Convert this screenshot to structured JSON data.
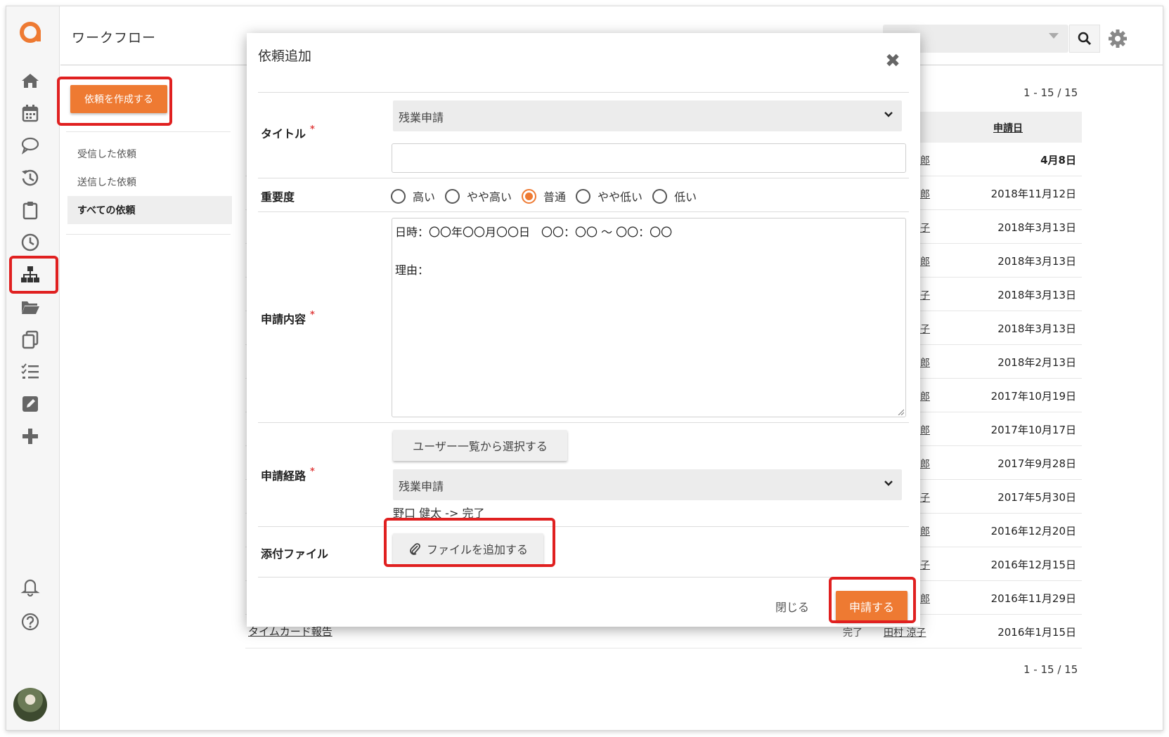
{
  "header": {
    "app_title": "ワークフロー",
    "search_icon": "search-icon",
    "settings_icon": "gear-icon"
  },
  "rail": {
    "items": [
      "logo-icon",
      "home-icon",
      "calendar-icon",
      "chat-icon",
      "history-icon",
      "clipboard-icon",
      "clock-icon",
      "workflow-icon",
      "folder-icon",
      "copy-icon",
      "checklist-icon",
      "edit-icon",
      "plus-icon",
      "bell-icon",
      "help-icon",
      "avatar"
    ]
  },
  "subnav": {
    "create_button": "依頼を作成する",
    "items": [
      {
        "label": "受信した依頼"
      },
      {
        "label": "送信した依頼"
      },
      {
        "label": "すべての依頼"
      }
    ]
  },
  "table": {
    "count_top": "1 - 15 / 15",
    "count_bottom": "1 - 15 / 15",
    "date_header": "申請日",
    "rows": [
      {
        "user": "郎",
        "date": "4月8日"
      },
      {
        "user": "郎",
        "date": "2018年11月12日"
      },
      {
        "user": "子",
        "date": "2018年3月13日"
      },
      {
        "user": "郎",
        "date": "2018年3月13日"
      },
      {
        "user": "子",
        "date": "2018年3月13日"
      },
      {
        "user": "子",
        "date": "2018年3月13日"
      },
      {
        "user": "郎",
        "date": "2018年2月13日"
      },
      {
        "user": "郎",
        "date": "2017年10月19日"
      },
      {
        "user": "郎",
        "date": "2017年10月17日"
      },
      {
        "user": "郎",
        "date": "2017年9月28日"
      },
      {
        "user": "子",
        "date": "2017年5月30日"
      },
      {
        "user": "郎",
        "date": "2016年12月20日"
      },
      {
        "user": "子",
        "date": "2016年12月15日"
      },
      {
        "user": "郎",
        "date": "2016年11月29日"
      },
      {
        "title": "タイムカード報告",
        "status": "完了",
        "user": "田村 涼子",
        "date": "2016年1月15日"
      }
    ]
  },
  "modal": {
    "title": "依頼追加",
    "close_icon": "close-icon",
    "required_mark": "*",
    "fields": {
      "title": {
        "label": "タイトル",
        "selected": "残業申請",
        "input_value": ""
      },
      "priority": {
        "label": "重要度",
        "options": [
          "高い",
          "やや高い",
          "普通",
          "やや低い",
          "低い"
        ],
        "selected": "普通"
      },
      "content": {
        "label": "申請内容",
        "lines": [
          "日時：〇〇年〇〇月〇〇日　〇〇：〇〇 ～ 〇〇：〇〇",
          "",
          "理由："
        ]
      },
      "route": {
        "label": "申請経路",
        "select_users_button": "ユーザー一覧から選択する",
        "selected": "残業申請",
        "route_text": "野口 健太 -> 完了"
      },
      "attachment": {
        "label": "添付ファイル",
        "button": "ファイルを追加する"
      }
    },
    "footer": {
      "close_label": "閉じる",
      "submit_label": "申請する"
    }
  },
  "colors": {
    "accent": "#ee7a32",
    "highlight": "#e02020"
  }
}
